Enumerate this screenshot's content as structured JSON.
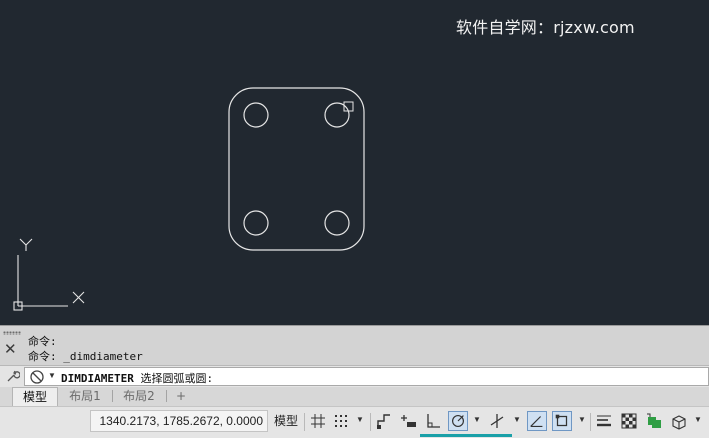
{
  "watermark": "软件自学网：rjzxw.com",
  "canvas": {
    "ucs_x_label": "X",
    "ucs_y_label": "Y"
  },
  "command": {
    "history": [
      "命令:",
      "命令: _dimdiameter"
    ],
    "prompt_command": "DIMDIAMETER",
    "prompt_text": " 选择圆弧或圆:"
  },
  "tabs": [
    "模型",
    "布局1",
    "布局2",
    "+"
  ],
  "status": {
    "coordinates": "1340.2173, 1785.2672, 0.0000",
    "model_button": "模型"
  },
  "icons": {
    "close": "close-icon",
    "wrench": "wrench-icon",
    "recent": "recent-commands-icon",
    "grid": "grid-icon",
    "snap": "snap-icon",
    "dynamic_input": "dynamic-input-icon",
    "ortho": "ortho-icon",
    "polar": "polar-tracking-icon",
    "osnap_tracking": "object-snap-tracking-icon",
    "osnap": "object-snap-icon",
    "lineweight": "lineweight-icon",
    "transparency": "transparency-icon",
    "selection_cycling": "selection-cycling-icon",
    "isometric": "isometric-icon"
  },
  "colors": {
    "canvas_bg": "#212830",
    "drawing_lines": "#e6e6e6",
    "toggle_on_bg": "#cfe0f2"
  }
}
